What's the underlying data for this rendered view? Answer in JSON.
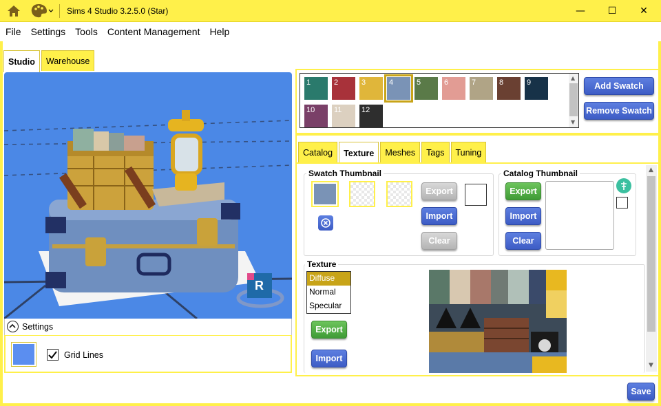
{
  "window": {
    "title": "Sims 4 Studio 3.2.5.0 (Star)",
    "controls": {
      "minimize": "—",
      "maximize": "☐",
      "close": "✕"
    }
  },
  "menu": [
    "File",
    "Settings",
    "Tools",
    "Content Management",
    "Help"
  ],
  "left_tabs": [
    "Studio",
    "Warehouse"
  ],
  "viewport": {
    "badge_letter": "R"
  },
  "settings": {
    "header": "Settings",
    "grid_lines_label": "Grid Lines",
    "grid_lines_checked": true,
    "background_color": "#5b8ef0"
  },
  "swatches": [
    {
      "label": "1",
      "color": "#2a7a6c"
    },
    {
      "label": "2",
      "color": "#a8323a"
    },
    {
      "label": "3",
      "color": "#e0b63a"
    },
    {
      "label": "4",
      "color": "#7a93b6"
    },
    {
      "label": "5",
      "color": "#5a7a48"
    },
    {
      "label": "6",
      "color": "#e29c94"
    },
    {
      "label": "7",
      "color": "#b0a486"
    },
    {
      "label": "8",
      "color": "#6a4032"
    },
    {
      "label": "9",
      "color": "#173248"
    },
    {
      "label": "10",
      "color": "#7a4068"
    },
    {
      "label": "11",
      "color": "#dcd0c0"
    },
    {
      "label": "12",
      "color": "#2e2e2e"
    }
  ],
  "swatch_buttons": {
    "add": "Add Swatch",
    "remove": "Remove Swatch"
  },
  "right_tabs": [
    "Catalog",
    "Texture",
    "Meshes",
    "Tags",
    "Tuning"
  ],
  "swatch_thumbnail": {
    "title": "Swatch Thumbnail",
    "export": "Export",
    "import": "Import",
    "clear": "Clear"
  },
  "catalog_thumbnail": {
    "title": "Catalog Thumbnail",
    "export": "Export",
    "import": "Import",
    "clear": "Clear"
  },
  "texture": {
    "title": "Texture",
    "options": [
      "Diffuse",
      "Normal",
      "Specular"
    ],
    "selected": "Diffuse",
    "export": "Export",
    "import": "Import"
  },
  "save_label": "Save"
}
